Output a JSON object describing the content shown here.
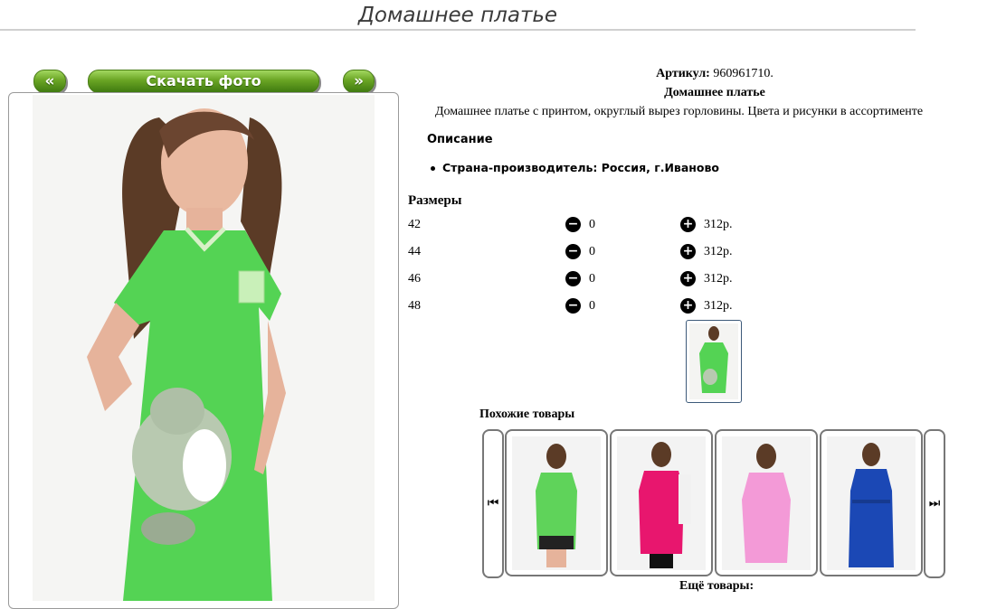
{
  "page": {
    "title": "Домашнее платье"
  },
  "nav": {
    "prev": "«",
    "next": "»",
    "download": "Скачать фото"
  },
  "product": {
    "sku_label": "Артикул:",
    "sku": "960961710.",
    "name": "Домашнее платье",
    "description": "Домашнее платье с принтом, округлый вырез горловины. Цвета и рисунки в ассортименте",
    "details_heading": "Описание",
    "details": [
      "Страна-производитель: Россия, г.Иваново"
    ]
  },
  "sizes": {
    "heading": "Размеры",
    "rows": [
      {
        "size": "42",
        "qty": "0",
        "price": "312р."
      },
      {
        "size": "44",
        "qty": "0",
        "price": "312р."
      },
      {
        "size": "46",
        "qty": "0",
        "price": "312р."
      },
      {
        "size": "48",
        "qty": "0",
        "price": "312р."
      }
    ]
  },
  "similar": {
    "heading": "Похожие товары",
    "more": "Ещё товары:",
    "items": [
      {
        "color": "#5fd35a",
        "accent": "#222222"
      },
      {
        "color": "#e8166e",
        "accent": "#f1f1f1"
      },
      {
        "color": "#f39ad7",
        "accent": "#f39ad7"
      },
      {
        "color": "#1b48b5",
        "accent": "#163a8f"
      }
    ]
  },
  "icons": {
    "minus": "minus-circle-icon",
    "plus": "plus-circle-icon",
    "prev": "skip-back-icon",
    "next": "skip-forward-icon"
  },
  "colors": {
    "accent": "#6aa524",
    "dress": "#54d354"
  }
}
